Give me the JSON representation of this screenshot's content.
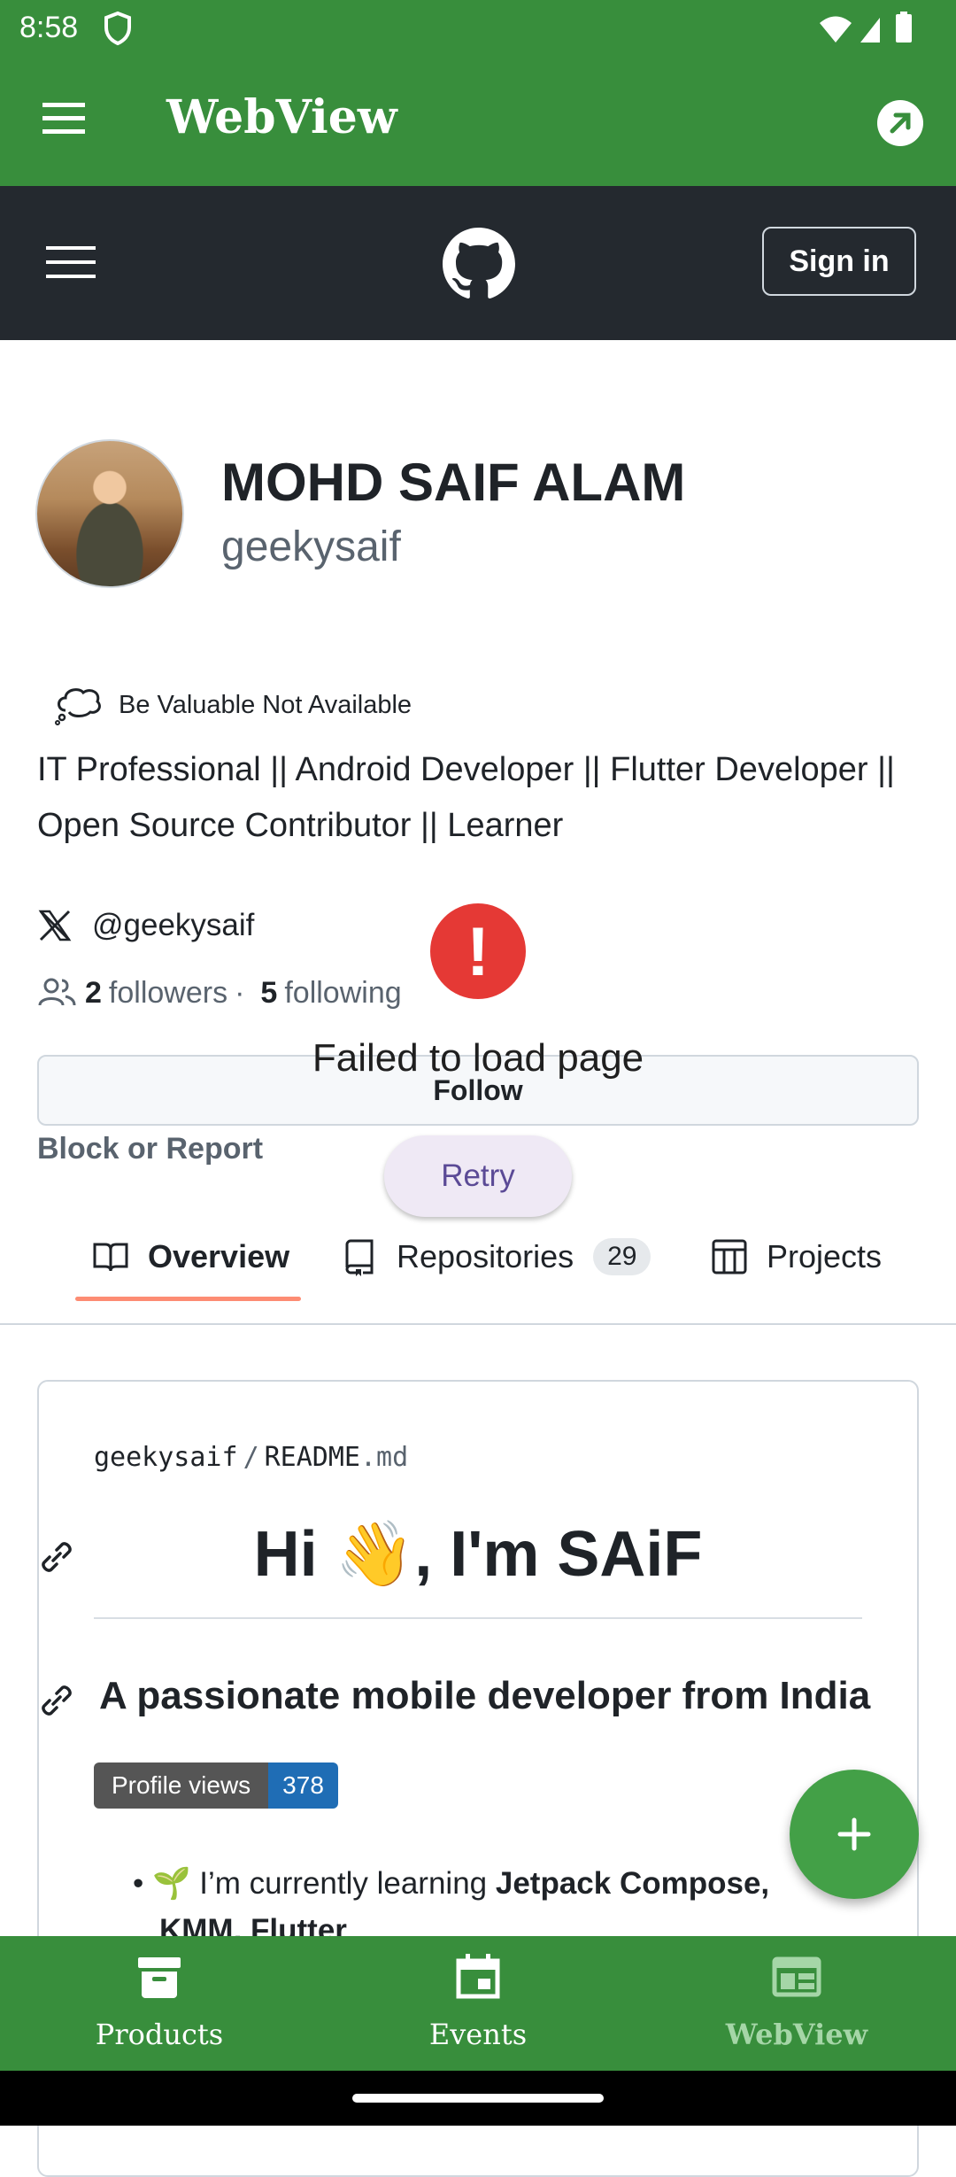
{
  "status_bar": {
    "time": "8:58"
  },
  "app_bar": {
    "title": "WebView"
  },
  "github_header": {
    "signin_label": "Sign in"
  },
  "profile": {
    "name": "MOHD SAIF ALAM",
    "username": "geekysaif",
    "status": "Be Valuable Not Available",
    "bio": "IT Professional || Android Developer || Flutter Developer || Open Source Contributor || Learner",
    "x_handle": "@geekysaif",
    "followers_count": "2",
    "followers_label": "followers",
    "separator": "·",
    "following_count": "5",
    "following_label": "following",
    "follow_label": "Follow",
    "block_report_label": "Block or Report"
  },
  "error": {
    "icon": "!",
    "message": "Failed to load page",
    "retry_label": "Retry"
  },
  "tabs": [
    {
      "label": "Overview",
      "icon": "book-icon",
      "active": true
    },
    {
      "label": "Repositories",
      "icon": "repo-icon",
      "count": "29"
    },
    {
      "label": "Projects",
      "icon": "table-icon"
    }
  ],
  "readme": {
    "owner": "geekysaif",
    "separator": "/",
    "file_base": "README",
    "file_ext": ".md",
    "heading": "Hi 👋, I'm SAiF",
    "subheading": "A passionate mobile developer from India",
    "badge_label": "Profile views",
    "badge_value": "378",
    "bullet_prefix": "🌱 I’m currently learning ",
    "bullet_bold": "Jetpack Compose,",
    "bullet_cont": "KMM, Flutter"
  },
  "bottom_nav": [
    {
      "label": "Products",
      "icon": "archive-icon"
    },
    {
      "label": "Events",
      "icon": "calendar-icon"
    },
    {
      "label": "WebView",
      "icon": "webview-icon",
      "active": true
    }
  ],
  "colors": {
    "app_green": "#388e3c",
    "github_dark": "#24292f",
    "error_red": "#e53935",
    "tab_accent": "#fd8c73",
    "fab_green": "#43a047"
  }
}
